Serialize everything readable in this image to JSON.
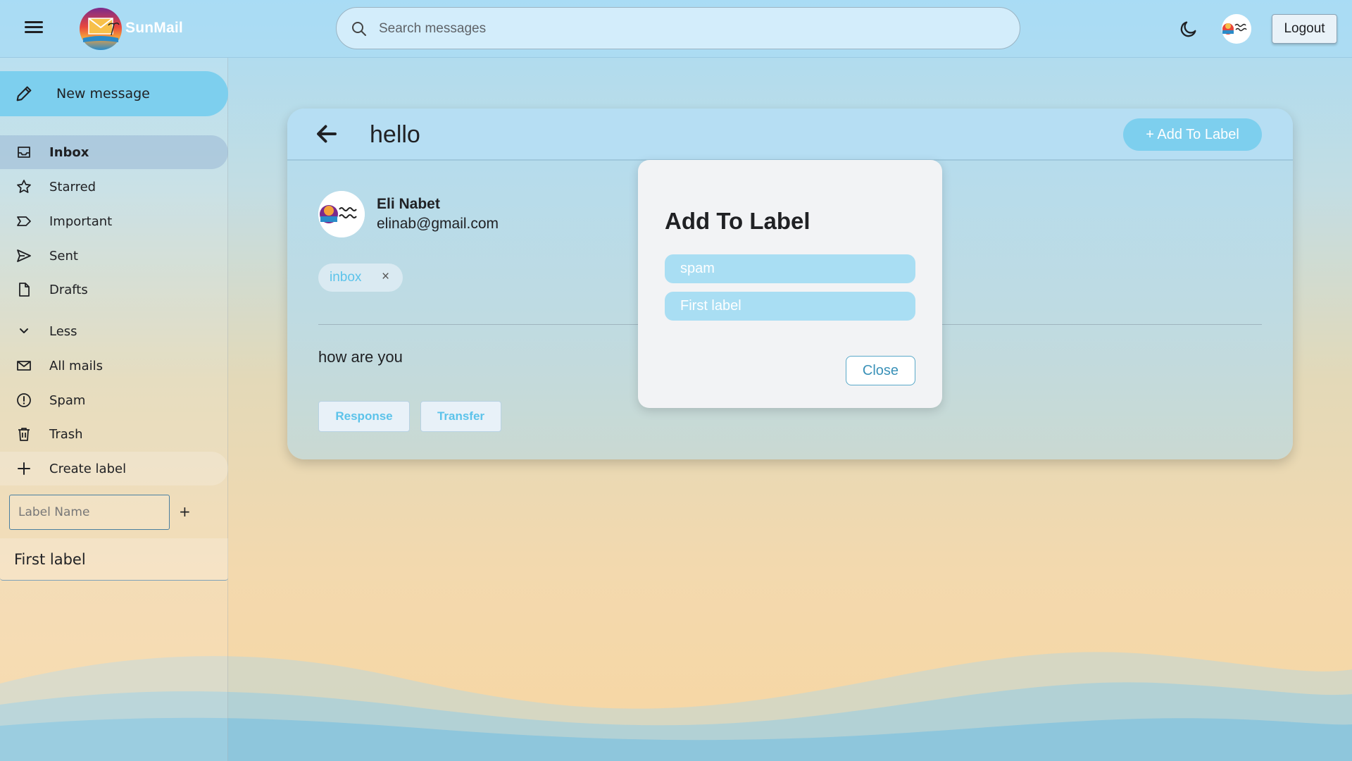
{
  "app": {
    "name": "SunMail"
  },
  "header": {
    "search_placeholder": "Search messages",
    "logout_label": "Logout"
  },
  "sidebar": {
    "new_message_label": "New message",
    "items": [
      {
        "label": "Inbox",
        "icon": "inbox-icon",
        "active": true
      },
      {
        "label": "Starred",
        "icon": "star-icon"
      },
      {
        "label": "Important",
        "icon": "important-icon"
      },
      {
        "label": "Sent",
        "icon": "send-icon"
      },
      {
        "label": "Drafts",
        "icon": "draft-icon"
      },
      {
        "label": "Less",
        "icon": "chevron-down-icon"
      },
      {
        "label": "All mails",
        "icon": "mail-icon"
      },
      {
        "label": "Spam",
        "icon": "spam-icon"
      },
      {
        "label": "Trash",
        "icon": "trash-icon"
      },
      {
        "label": "Create label",
        "icon": "plus-icon"
      }
    ],
    "label_input_placeholder": "Label Name",
    "label_add_symbol": "+",
    "user_labels": [
      "First label"
    ]
  },
  "email": {
    "subject": "hello",
    "add_to_label_button": "+ Add To Label",
    "sender_name": "Eli Nabet",
    "sender_email": "elinab@gmail.com",
    "labels": [
      {
        "name": "inbox",
        "remove_symbol": "×"
      }
    ],
    "body": "how are you",
    "actions": {
      "response": "Response",
      "transfer": "Transfer"
    }
  },
  "modal": {
    "title": "Add To Label",
    "options": [
      "spam",
      "First label"
    ],
    "close_label": "Close"
  },
  "colors": {
    "accent": "#7dcfee",
    "chip_text": "#5cc3ea",
    "option_bg": "#a9def3"
  }
}
